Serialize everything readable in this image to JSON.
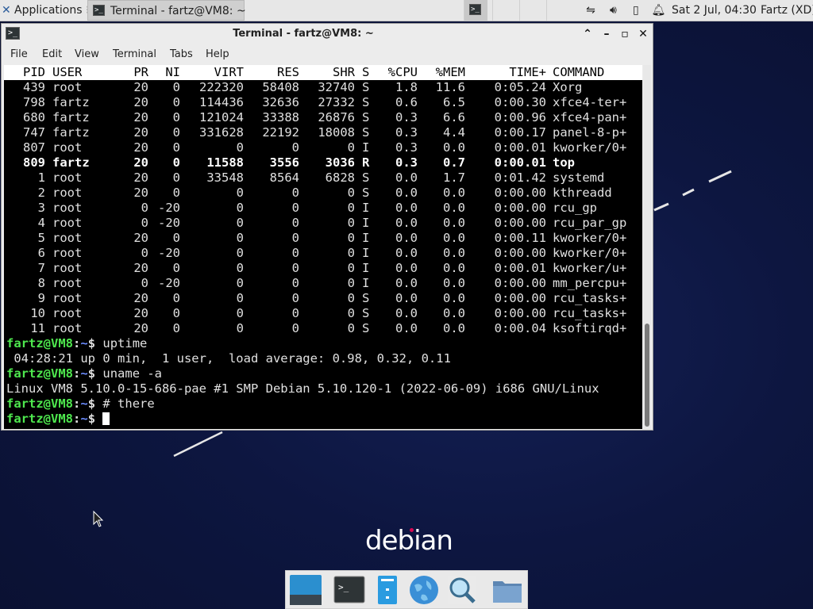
{
  "panel": {
    "applications_label": "Applications",
    "taskbar_label": "Terminal - fartz@VM8: ~",
    "datetime": "Sat  2 Jul, 04:30",
    "user": "Fartz (XD)"
  },
  "window": {
    "title": "Terminal - fartz@VM8: ~",
    "menu": [
      "File",
      "Edit",
      "View",
      "Terminal",
      "Tabs",
      "Help"
    ]
  },
  "top_header": [
    "PID",
    "USER",
    "PR",
    "NI",
    "VIRT",
    "RES",
    "SHR",
    "S",
    "%CPU",
    "%MEM",
    "TIME+",
    "COMMAND"
  ],
  "processes": [
    {
      "pid": "439",
      "user": "root",
      "pr": "20",
      "ni": "0",
      "virt": "222320",
      "res": "58408",
      "shr": "32740",
      "s": "S",
      "cpu": "1.8",
      "mem": "11.6",
      "time": "0:05.24",
      "cmd": "Xorg"
    },
    {
      "pid": "798",
      "user": "fartz",
      "pr": "20",
      "ni": "0",
      "virt": "114436",
      "res": "32636",
      "shr": "27332",
      "s": "S",
      "cpu": "0.6",
      "mem": "6.5",
      "time": "0:00.30",
      "cmd": "xfce4-ter+"
    },
    {
      "pid": "680",
      "user": "fartz",
      "pr": "20",
      "ni": "0",
      "virt": "121024",
      "res": "33388",
      "shr": "26876",
      "s": "S",
      "cpu": "0.3",
      "mem": "6.6",
      "time": "0:00.96",
      "cmd": "xfce4-pan+"
    },
    {
      "pid": "747",
      "user": "fartz",
      "pr": "20",
      "ni": "0",
      "virt": "331628",
      "res": "22192",
      "shr": "18008",
      "s": "S",
      "cpu": "0.3",
      "mem": "4.4",
      "time": "0:00.17",
      "cmd": "panel-8-p+"
    },
    {
      "pid": "807",
      "user": "root",
      "pr": "20",
      "ni": "0",
      "virt": "0",
      "res": "0",
      "shr": "0",
      "s": "I",
      "cpu": "0.3",
      "mem": "0.0",
      "time": "0:00.01",
      "cmd": "kworker/0+"
    },
    {
      "pid": "809",
      "user": "fartz",
      "pr": "20",
      "ni": "0",
      "virt": "11588",
      "res": "3556",
      "shr": "3036",
      "s": "R",
      "cpu": "0.3",
      "mem": "0.7",
      "time": "0:00.01",
      "cmd": "top",
      "bold": true
    },
    {
      "pid": "1",
      "user": "root",
      "pr": "20",
      "ni": "0",
      "virt": "33548",
      "res": "8564",
      "shr": "6828",
      "s": "S",
      "cpu": "0.0",
      "mem": "1.7",
      "time": "0:01.42",
      "cmd": "systemd"
    },
    {
      "pid": "2",
      "user": "root",
      "pr": "20",
      "ni": "0",
      "virt": "0",
      "res": "0",
      "shr": "0",
      "s": "S",
      "cpu": "0.0",
      "mem": "0.0",
      "time": "0:00.00",
      "cmd": "kthreadd"
    },
    {
      "pid": "3",
      "user": "root",
      "pr": "0",
      "ni": "-20",
      "virt": "0",
      "res": "0",
      "shr": "0",
      "s": "I",
      "cpu": "0.0",
      "mem": "0.0",
      "time": "0:00.00",
      "cmd": "rcu_gp"
    },
    {
      "pid": "4",
      "user": "root",
      "pr": "0",
      "ni": "-20",
      "virt": "0",
      "res": "0",
      "shr": "0",
      "s": "I",
      "cpu": "0.0",
      "mem": "0.0",
      "time": "0:00.00",
      "cmd": "rcu_par_gp"
    },
    {
      "pid": "5",
      "user": "root",
      "pr": "20",
      "ni": "0",
      "virt": "0",
      "res": "0",
      "shr": "0",
      "s": "I",
      "cpu": "0.0",
      "mem": "0.0",
      "time": "0:00.11",
      "cmd": "kworker/0+"
    },
    {
      "pid": "6",
      "user": "root",
      "pr": "0",
      "ni": "-20",
      "virt": "0",
      "res": "0",
      "shr": "0",
      "s": "I",
      "cpu": "0.0",
      "mem": "0.0",
      "time": "0:00.00",
      "cmd": "kworker/0+"
    },
    {
      "pid": "7",
      "user": "root",
      "pr": "20",
      "ni": "0",
      "virt": "0",
      "res": "0",
      "shr": "0",
      "s": "I",
      "cpu": "0.0",
      "mem": "0.0",
      "time": "0:00.01",
      "cmd": "kworker/u+"
    },
    {
      "pid": "8",
      "user": "root",
      "pr": "0",
      "ni": "-20",
      "virt": "0",
      "res": "0",
      "shr": "0",
      "s": "I",
      "cpu": "0.0",
      "mem": "0.0",
      "time": "0:00.00",
      "cmd": "mm_percpu+"
    },
    {
      "pid": "9",
      "user": "root",
      "pr": "20",
      "ni": "0",
      "virt": "0",
      "res": "0",
      "shr": "0",
      "s": "S",
      "cpu": "0.0",
      "mem": "0.0",
      "time": "0:00.00",
      "cmd": "rcu_tasks+"
    },
    {
      "pid": "10",
      "user": "root",
      "pr": "20",
      "ni": "0",
      "virt": "0",
      "res": "0",
      "shr": "0",
      "s": "S",
      "cpu": "0.0",
      "mem": "0.0",
      "time": "0:00.00",
      "cmd": "rcu_tasks+"
    },
    {
      "pid": "11",
      "user": "root",
      "pr": "20",
      "ni": "0",
      "virt": "0",
      "res": "0",
      "shr": "0",
      "s": "S",
      "cpu": "0.0",
      "mem": "0.0",
      "time": "0:00.04",
      "cmd": "ksoftirqd+"
    }
  ],
  "shell": {
    "prompt_user": "fartz@VM8",
    "prompt_sep": ":",
    "prompt_path": "~",
    "prompt_end": "$",
    "lines": [
      {
        "type": "cmd",
        "text": " uptime"
      },
      {
        "type": "out",
        "text": " 04:28:21 up 0 min,  1 user,  load average: 0.98, 0.32, 0.11"
      },
      {
        "type": "cmd",
        "text": " uname -a"
      },
      {
        "type": "out",
        "text": "Linux VM8 5.10.0-15-686-pae #1 SMP Debian 5.10.120-1 (2022-06-09) i686 GNU/Linux"
      },
      {
        "type": "cmd",
        "text": " # there"
      },
      {
        "type": "cmd",
        "text": " ",
        "cursor": true
      }
    ]
  },
  "desktop": {
    "logo_text": "debian"
  },
  "dock": {
    "items": [
      "show-desktop-icon",
      "terminal-icon",
      "file-manager-icon",
      "web-browser-icon",
      "app-finder-icon",
      "folder-icon"
    ]
  }
}
